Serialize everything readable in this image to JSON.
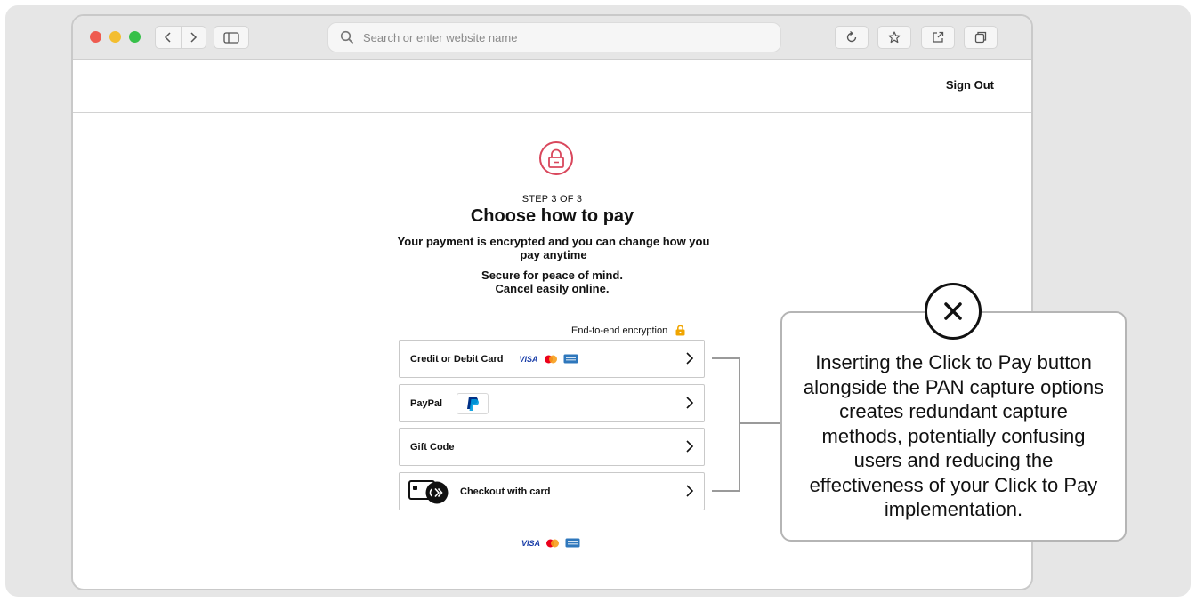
{
  "browser": {
    "address_placeholder": "Search or enter website name",
    "icons": [
      "back-icon",
      "forward-icon",
      "sidebar-icon",
      "search-icon",
      "reload-icon",
      "bookmark-star-icon",
      "share-icon",
      "tabs-icon"
    ]
  },
  "header": {
    "sign_out_label": "Sign Out"
  },
  "checkout": {
    "step": "STEP 3 OF 3",
    "title": "Choose how to pay",
    "subtitle": "Your payment is encrypted and you can change how you pay anytime",
    "secure_line1": "Secure for peace of mind.",
    "secure_line2": "Cancel easily online.",
    "encryption_label": "End-to-end encryption",
    "options": [
      {
        "label": "Credit or Debit Card",
        "logos": [
          "VISA",
          "mastercard",
          "amex"
        ]
      },
      {
        "label": "PayPal",
        "logos": [
          "paypal"
        ]
      },
      {
        "label": "Gift Code",
        "logos": []
      },
      {
        "label": "Checkout with card",
        "logos": [
          "click-to-pay"
        ]
      }
    ],
    "footer_logos": [
      "VISA",
      "mastercard",
      "amex"
    ]
  },
  "callout": {
    "text": "Inserting the Click to Pay button alongside the PAN capture options creates redundant capture methods, potentially confusing users and reducing the effectiveness of your Click to Pay implementation.",
    "icon": "close-x-icon"
  },
  "colors": {
    "lock_accent": "#d9475c",
    "encryption_lock": "#f0a500",
    "visa_blue": "#1a3ea8",
    "paypal_dark": "#003087",
    "paypal_light": "#009cde"
  }
}
